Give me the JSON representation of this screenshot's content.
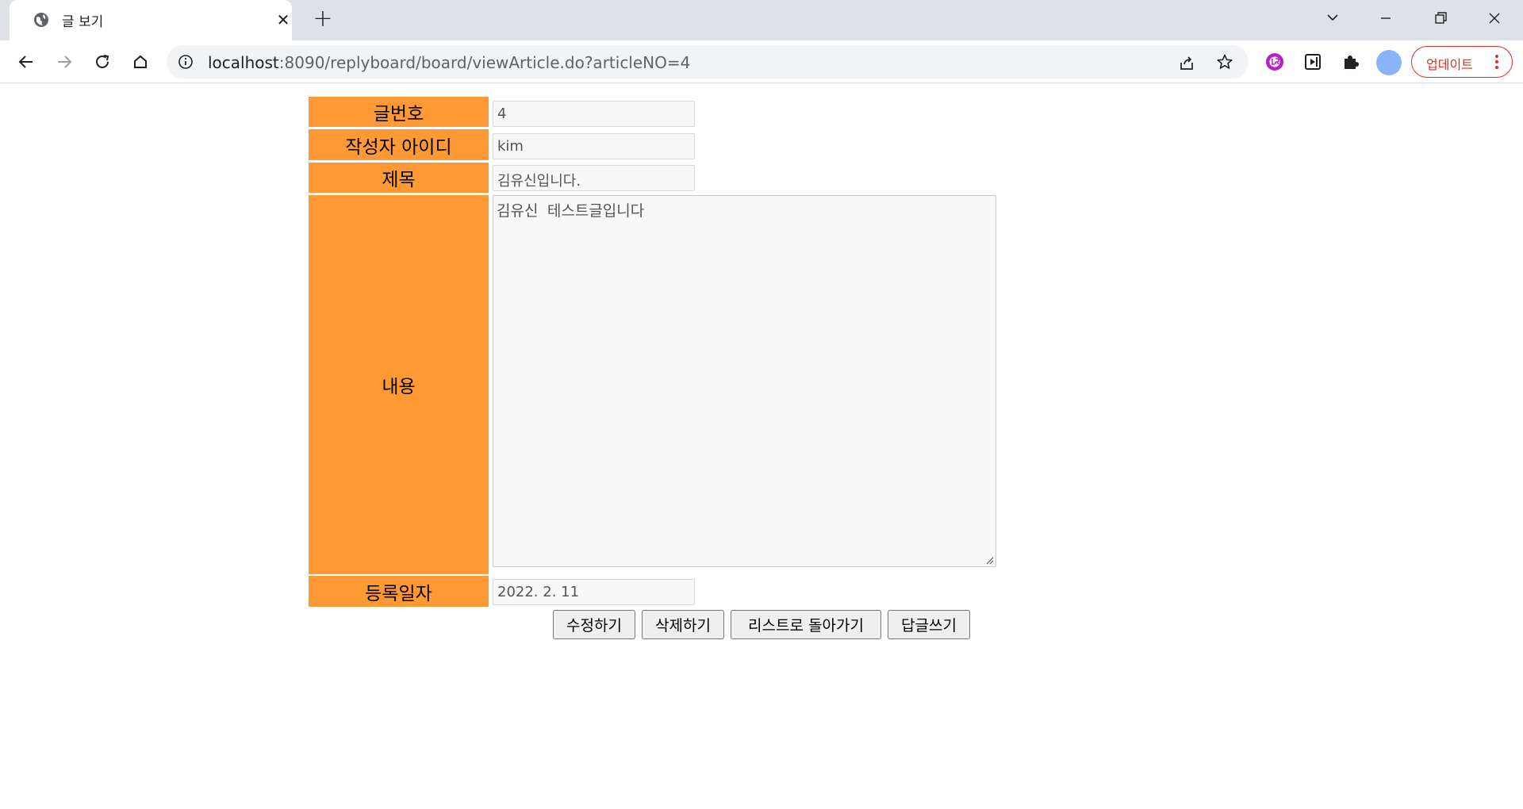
{
  "browser": {
    "tab": {
      "title": "글 보기",
      "favicon": "globe-icon"
    },
    "address": {
      "host": "localhost",
      "path": ":8090/replyboard/board/viewArticle.do?articleNO=4"
    },
    "update_label": "업데이트",
    "extensions": [
      "lr-extension-icon",
      "media-extension-icon",
      "puzzle-extensions-icon"
    ]
  },
  "article": {
    "rows": {
      "number": {
        "label": "글번호",
        "value": "4"
      },
      "author": {
        "label": "작성자 아이디",
        "value": "kim"
      },
      "title": {
        "label": "제목",
        "value": "김유신입니다."
      },
      "content": {
        "label": "내용",
        "value": "김유신 테스트글입니다"
      },
      "date": {
        "label": "등록일자",
        "value": "2022. 2. 11"
      }
    },
    "buttons": {
      "modify": "수정하기",
      "delete": "삭제하기",
      "back_to_list": "리스트로 돌아가기",
      "reply": "답글쓰기"
    }
  },
  "colors": {
    "label_bg": "#ff9933",
    "update_accent": "#d93025",
    "avatar": "#8ab4f8"
  }
}
